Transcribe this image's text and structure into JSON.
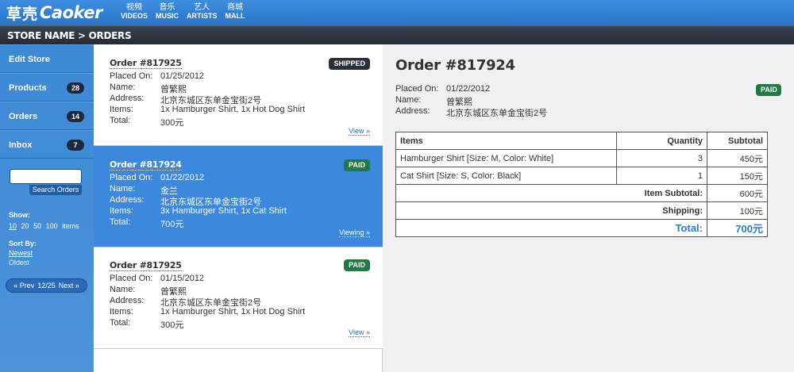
{
  "brand": {
    "cn": "草壳",
    "en": "Caoker"
  },
  "topnav": [
    {
      "cn": "视频",
      "en": "VIDEOS"
    },
    {
      "cn": "音乐",
      "en": "MUSIC"
    },
    {
      "cn": "艺人",
      "en": "ARTISTS"
    },
    {
      "cn": "商城",
      "en": "MALL"
    }
  ],
  "breadcrumb": "STORE NAME > ORDERS",
  "sidebar": {
    "items": [
      {
        "label": "Edit Store",
        "badge": ""
      },
      {
        "label": "Products",
        "badge": "28"
      },
      {
        "label": "Orders",
        "badge": "14"
      },
      {
        "label": "Inbox",
        "badge": "7"
      }
    ],
    "search_value": "",
    "search_button": "Search Orders",
    "show_label": "Show:",
    "show_options": [
      "10",
      "20",
      "50",
      "100",
      "items"
    ],
    "sort_label": "Sort By:",
    "sort_options": [
      "Newest",
      "Oldest"
    ],
    "pager": {
      "prev": "« Prev",
      "page": "12/25",
      "next": "Next »"
    }
  },
  "labels": {
    "placed_on": "Placed On:",
    "name": "Name:",
    "address": "Address:",
    "items": "Items:",
    "total": "Total:"
  },
  "orders": [
    {
      "title": "Order #817925",
      "status": "SHIPPED",
      "placed_on": "01/25/2012",
      "name": "曾繁熙",
      "address": "北京东城区东单金宝街2号",
      "items": "1x Hamburger Shirt, 1x Hot Dog Shirt",
      "total": "300元",
      "link": "View »"
    },
    {
      "title": "Order #817924",
      "status": "PAID",
      "placed_on": "01/22/2012",
      "name": "金兰",
      "address": "北京东城区东单金宝街2号",
      "items": "3x Hamburger Shirt, 1x Cat Shirt",
      "total": "700元",
      "link": "Viewing »"
    },
    {
      "title": "Order #817925",
      "status": "PAID",
      "placed_on": "01/15/2012",
      "name": "曾繁熙",
      "address": "北京东城区东单金宝街2号",
      "items": "1x Hamburger Shirt, 1x Hot Dog Shirt",
      "total": "300元",
      "link": "View »"
    }
  ],
  "detail": {
    "title": "Order #817924",
    "status": "PAID",
    "placed_on": "01/22/2012",
    "name": "曾繁熙",
    "address": "北京东城区东单金宝街2号",
    "table": {
      "headers": [
        "Items",
        "Quantity",
        "Subtotal"
      ],
      "rows": [
        {
          "item": "Hamburger Shirt [Size: M, Color: White]",
          "qty": "3",
          "subtotal": "450元"
        },
        {
          "item": "Cat Shirt [Size: S, Color: Black]",
          "qty": "1",
          "subtotal": "150元"
        }
      ],
      "item_subtotal_label": "Item Subtotal:",
      "item_subtotal": "600元",
      "shipping_label": "Shipping:",
      "shipping": "100元",
      "total_label": "Total:",
      "total": "700元"
    }
  },
  "colors": {
    "brand_blue": "#2a74c8",
    "paid": "#1f7a44",
    "shipped": "#2a2f38",
    "total_blue": "#2a7bd0"
  }
}
